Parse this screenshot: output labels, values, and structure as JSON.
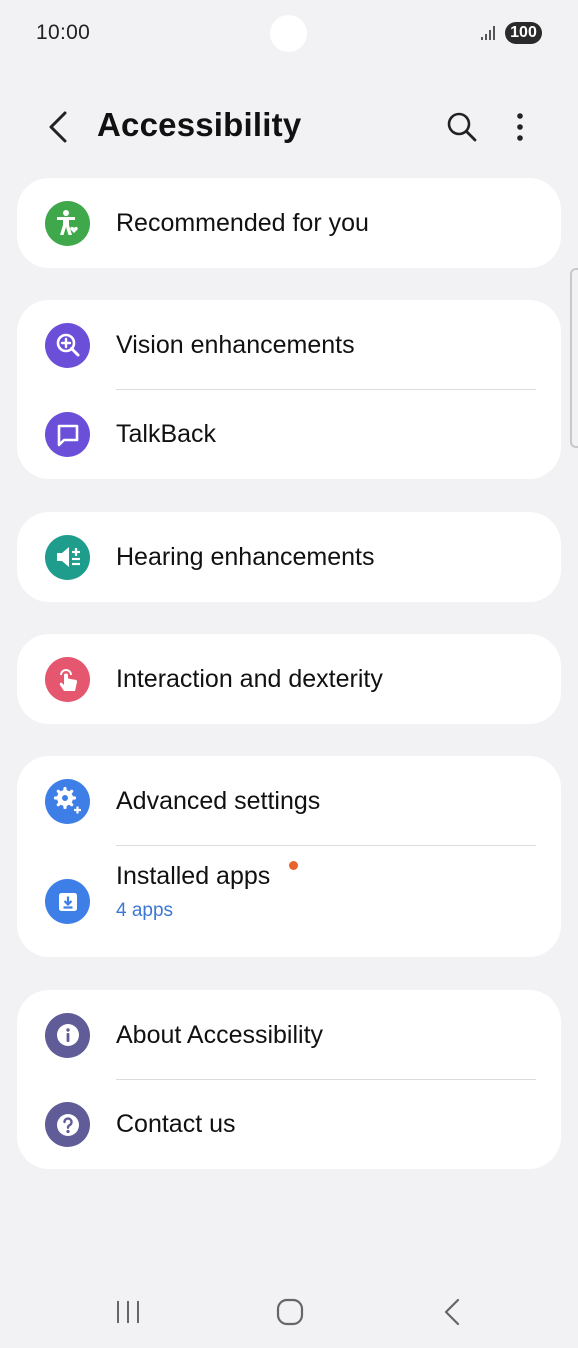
{
  "status_bar": {
    "time": "10:00",
    "battery": "100"
  },
  "header": {
    "title": "Accessibility",
    "icons": {
      "back": "back-arrow-icon",
      "search": "search-icon",
      "more": "more-vertical-icon"
    }
  },
  "sections": {
    "recommended": {
      "label": "Recommended for you",
      "icon": "accessibility-heart-icon",
      "color": "#3fa84a"
    },
    "vision": {
      "label": "Vision enhancements",
      "icon": "zoom-in-icon",
      "color": "#6b4fd8"
    },
    "talkback": {
      "label": "TalkBack",
      "icon": "chat-bubble-icon",
      "color": "#6b4fd8"
    },
    "hearing": {
      "label": "Hearing enhancements",
      "icon": "speaker-plus-icon",
      "color": "#1e9c8c"
    },
    "interaction": {
      "label": "Interaction and dexterity",
      "icon": "touch-hand-icon",
      "color": "#e5566f"
    },
    "advanced": {
      "label": "Advanced settings",
      "icon": "gear-plus-icon",
      "color": "#3d7fe6"
    },
    "installed": {
      "label": "Installed apps",
      "sublabel": "4 apps",
      "icon": "download-box-icon",
      "color": "#3d7fe6",
      "badge_color": "#e8632b"
    },
    "about": {
      "label": "About Accessibility",
      "icon": "info-icon",
      "color": "#5f5c97"
    },
    "contact": {
      "label": "Contact us",
      "icon": "help-icon",
      "color": "#5f5c97"
    }
  },
  "nav_bar": {
    "recents": "recents-icon",
    "home": "home-icon",
    "back": "nav-back-icon"
  }
}
